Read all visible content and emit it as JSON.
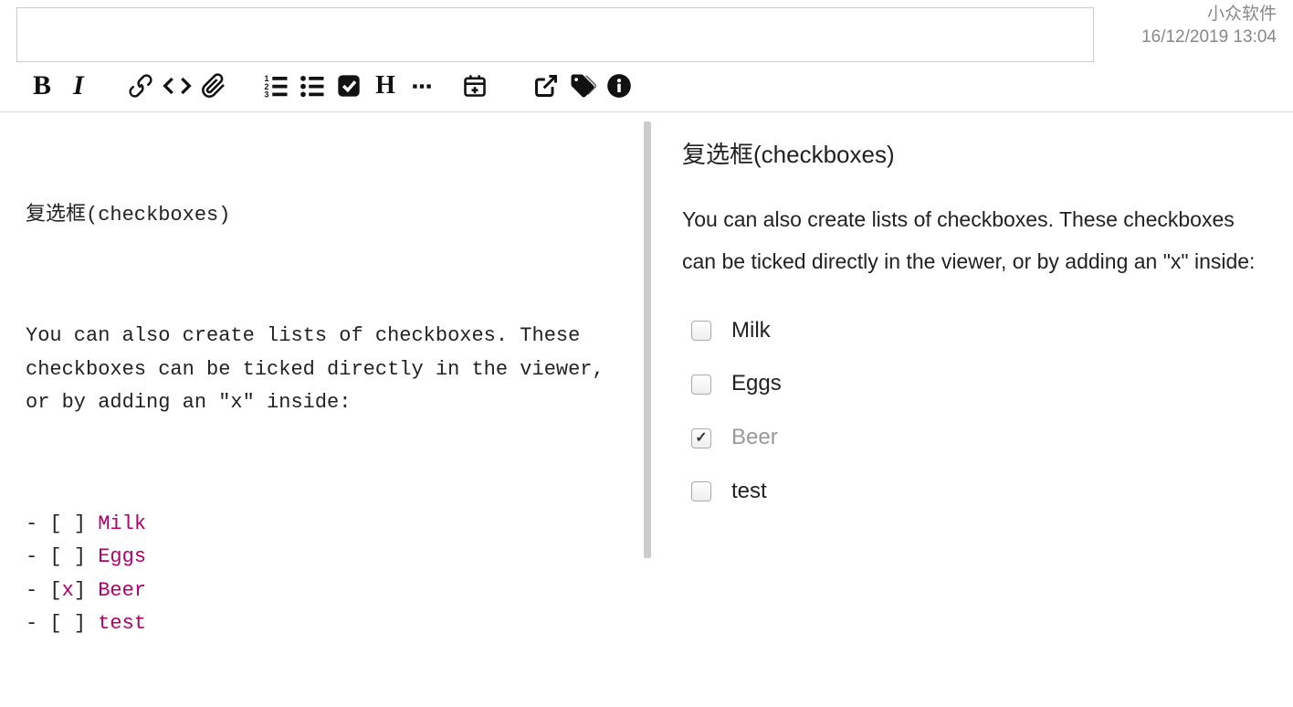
{
  "meta": {
    "app_name": "小众软件",
    "datetime": "16/12/2019 13:04"
  },
  "title_input": {
    "value": "",
    "placeholder": ""
  },
  "toolbar": {
    "bold": "B",
    "italic": "I",
    "link": "link-icon",
    "code": "code-icon",
    "attach": "attach-icon",
    "olist": "ordered-list-icon",
    "ulist": "unordered-list-icon",
    "checkbox": "checkbox-icon",
    "heading": "H",
    "hr": "hr-icon",
    "date": "calendar-add-icon",
    "external": "external-link-icon",
    "tag": "tag-icon",
    "info": "info-icon"
  },
  "editor": {
    "title": "复选框(checkboxes)",
    "paragraph": "You can also create lists of checkboxes. These checkboxes can be ticked directly in the viewer, or by adding an \"x\" inside:",
    "items": [
      {
        "mark": " ",
        "label": "Milk"
      },
      {
        "mark": " ",
        "label": "Eggs"
      },
      {
        "mark": "x",
        "label": "Beer"
      },
      {
        "mark": " ",
        "label": "test"
      }
    ]
  },
  "preview": {
    "title": "复选框(checkboxes)",
    "paragraph": "You can also create lists of checkboxes. These checkboxes can be ticked directly in the viewer, or by adding an \"x\" inside:",
    "items": [
      {
        "checked": false,
        "label": "Milk"
      },
      {
        "checked": false,
        "label": "Eggs"
      },
      {
        "checked": true,
        "label": "Beer"
      },
      {
        "checked": false,
        "label": "test"
      }
    ]
  }
}
